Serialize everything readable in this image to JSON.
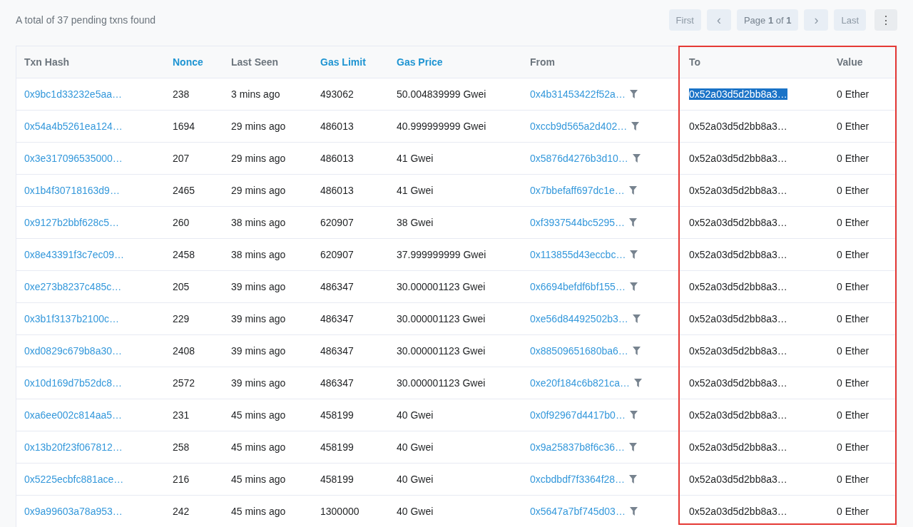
{
  "summary": "A total of 37 pending txns found",
  "pagination": {
    "first": "First",
    "prev": "‹",
    "page": "Page **1** of **1**",
    "next": "›",
    "last": "Last",
    "menu": "⋮"
  },
  "table": {
    "columns": [
      {
        "label": "Txn Hash",
        "sortable": false
      },
      {
        "label": "Nonce",
        "sortable": true
      },
      {
        "label": "Last Seen",
        "sortable": false
      },
      {
        "label": "Gas Limit",
        "sortable": true
      },
      {
        "label": "Gas Price",
        "sortable": true
      },
      {
        "label": "From",
        "sortable": false
      },
      {
        "label": "To",
        "sortable": false
      },
      {
        "label": "Value",
        "sortable": false
      }
    ],
    "red_frame_around_to_and_value": true,
    "rows": [
      {
        "hash": "0x9bc1d33232e5aa…",
        "nonce": "238",
        "last_seen": "3 mins ago",
        "gas_limit": "493062",
        "gas_price": "50.004839999 Gwei",
        "from": "0x4b31453422f52a…",
        "to": "0x52a03d5d2bb8a3…",
        "to_selected": true,
        "value": "0 Ether"
      },
      {
        "hash": "0x54a4b5261ea124…",
        "nonce": "1694",
        "last_seen": "29 mins ago",
        "gas_limit": "486013",
        "gas_price": "40.999999999 Gwei",
        "from": "0xccb9d565a2d402…",
        "to": "0x52a03d5d2bb8a3…",
        "to_selected": false,
        "value": "0 Ether"
      },
      {
        "hash": "0x3e317096535000…",
        "nonce": "207",
        "last_seen": "29 mins ago",
        "gas_limit": "486013",
        "gas_price": "41 Gwei",
        "from": "0x5876d4276b3d10…",
        "to": "0x52a03d5d2bb8a3…",
        "to_selected": false,
        "value": "0 Ether"
      },
      {
        "hash": "0x1b4f30718163d9…",
        "nonce": "2465",
        "last_seen": "29 mins ago",
        "gas_limit": "486013",
        "gas_price": "41 Gwei",
        "from": "0x7bbefaff697dc1e…",
        "to": "0x52a03d5d2bb8a3…",
        "to_selected": false,
        "value": "0 Ether"
      },
      {
        "hash": "0x9127b2bbf628c5…",
        "nonce": "260",
        "last_seen": "38 mins ago",
        "gas_limit": "620907",
        "gas_price": "38 Gwei",
        "from": "0xf3937544bc5295…",
        "to": "0x52a03d5d2bb8a3…",
        "to_selected": false,
        "value": "0 Ether"
      },
      {
        "hash": "0x8e43391f3c7ec09…",
        "nonce": "2458",
        "last_seen": "38 mins ago",
        "gas_limit": "620907",
        "gas_price": "37.999999999 Gwei",
        "from": "0x113855d43eccbc…",
        "to": "0x52a03d5d2bb8a3…",
        "to_selected": false,
        "value": "0 Ether"
      },
      {
        "hash": "0xe273b8237c485c…",
        "nonce": "205",
        "last_seen": "39 mins ago",
        "gas_limit": "486347",
        "gas_price": "30.000001123 Gwei",
        "from": "0x6694befdf6bf155…",
        "to": "0x52a03d5d2bb8a3…",
        "to_selected": false,
        "value": "0 Ether"
      },
      {
        "hash": "0x3b1f3137b2100c…",
        "nonce": "229",
        "last_seen": "39 mins ago",
        "gas_limit": "486347",
        "gas_price": "30.000001123 Gwei",
        "from": "0xe56d84492502b3…",
        "to": "0x52a03d5d2bb8a3…",
        "to_selected": false,
        "value": "0 Ether"
      },
      {
        "hash": "0xd0829c679b8a30…",
        "nonce": "2408",
        "last_seen": "39 mins ago",
        "gas_limit": "486347",
        "gas_price": "30.000001123 Gwei",
        "from": "0x88509651680ba6…",
        "to": "0x52a03d5d2bb8a3…",
        "to_selected": false,
        "value": "0 Ether"
      },
      {
        "hash": "0x10d169d7b52dc8…",
        "nonce": "2572",
        "last_seen": "39 mins ago",
        "gas_limit": "486347",
        "gas_price": "30.000001123 Gwei",
        "from": "0xe20f184c6b821ca…",
        "to": "0x52a03d5d2bb8a3…",
        "to_selected": false,
        "value": "0 Ether"
      },
      {
        "hash": "0xa6ee002c814aa5…",
        "nonce": "231",
        "last_seen": "45 mins ago",
        "gas_limit": "458199",
        "gas_price": "40 Gwei",
        "from": "0x0f92967d4417b0…",
        "to": "0x52a03d5d2bb8a3…",
        "to_selected": false,
        "value": "0 Ether"
      },
      {
        "hash": "0x13b20f23f067812…",
        "nonce": "258",
        "last_seen": "45 mins ago",
        "gas_limit": "458199",
        "gas_price": "40 Gwei",
        "from": "0x9a25837b8f6c36…",
        "to": "0x52a03d5d2bb8a3…",
        "to_selected": false,
        "value": "0 Ether"
      },
      {
        "hash": "0x5225ecbfc881ace…",
        "nonce": "216",
        "last_seen": "45 mins ago",
        "gas_limit": "458199",
        "gas_price": "40 Gwei",
        "from": "0xcbdbdf7f3364f28…",
        "to": "0x52a03d5d2bb8a3…",
        "to_selected": false,
        "value": "0 Ether"
      },
      {
        "hash": "0x9a99603a78a953…",
        "nonce": "242",
        "last_seen": "45 mins ago",
        "gas_limit": "1300000",
        "gas_price": "40 Gwei",
        "from": "0x5647a7bf745d03…",
        "to": "0x52a03d5d2bb8a3…",
        "to_selected": false,
        "value": "0 Ether"
      }
    ]
  }
}
